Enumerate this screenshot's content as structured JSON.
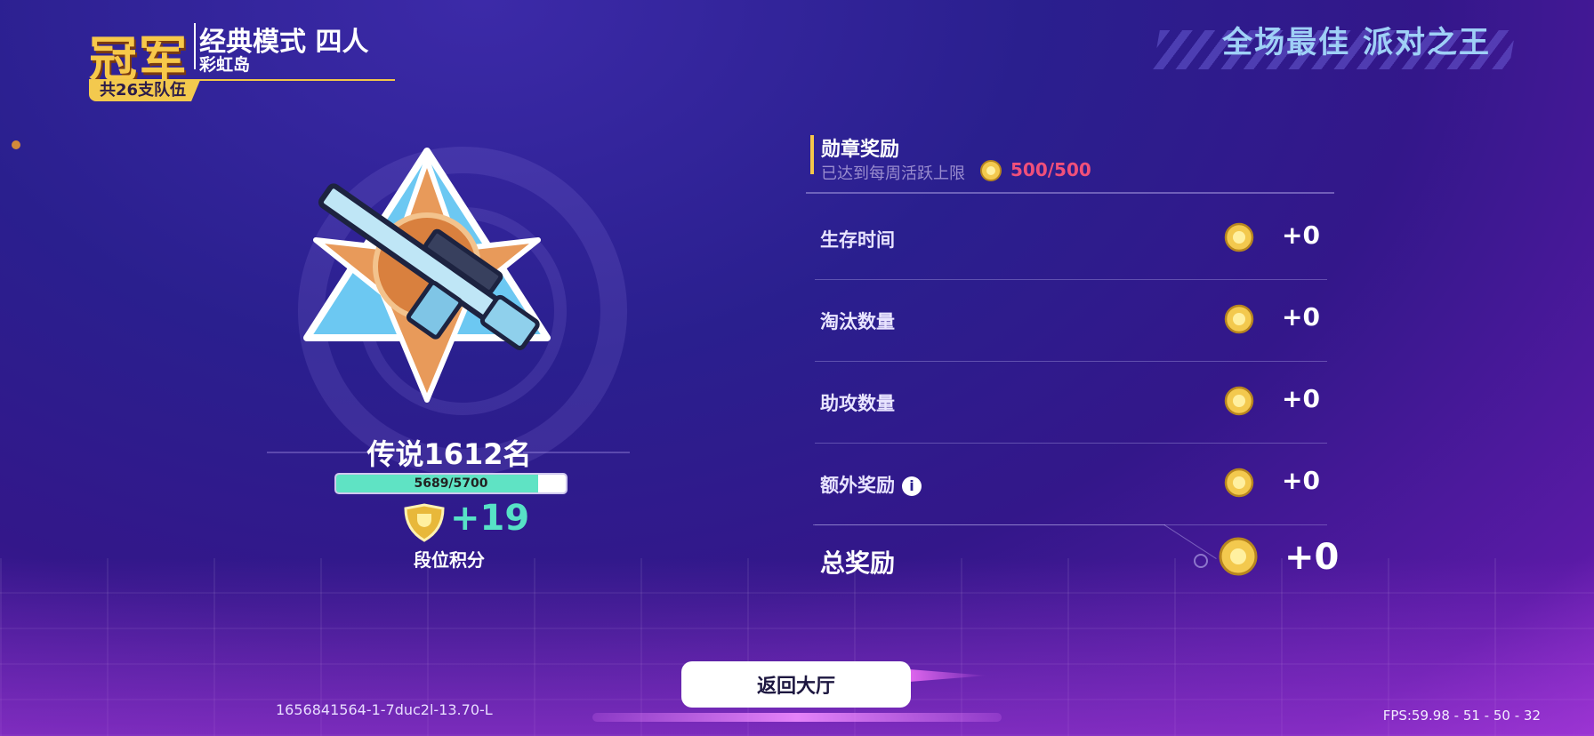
{
  "header": {
    "title": "冠军",
    "mode": "经典模式 四人",
    "map": "彩虹岛",
    "teams": "共26支队伍",
    "top_title": "全场最佳 派对之王"
  },
  "rank": {
    "label": "传说1612名",
    "progress_text": "5689/5700",
    "progress_fraction": 0.9979,
    "points": "+19",
    "points_label": "段位积分"
  },
  "medal": {
    "title": "勋章奖励",
    "subtitle": "已达到每周活跃上限",
    "cap_value": "500/500",
    "rows": [
      {
        "label": "生存时间",
        "value": "+0",
        "icon": "coin-icon"
      },
      {
        "label": "淘汰数量",
        "value": "+0",
        "icon": "coin-icon"
      },
      {
        "label": "助攻数量",
        "value": "+0",
        "icon": "coin-icon"
      },
      {
        "label": "额外奖励",
        "value": "+0",
        "icon": "coin-icon",
        "info": true
      }
    ],
    "total_label": "总奖励",
    "total_value": "+0"
  },
  "footer": {
    "back_button": "返回大厅",
    "build_id": "1656841564-1-7duc2l-13.70-L",
    "fps": "FPS:59.98 - 51 - 50 - 32"
  },
  "colors": {
    "gold": "#f3c94e",
    "teal": "#57e2c6",
    "pink": "#f0507a",
    "sky": "#9fd0f6"
  }
}
